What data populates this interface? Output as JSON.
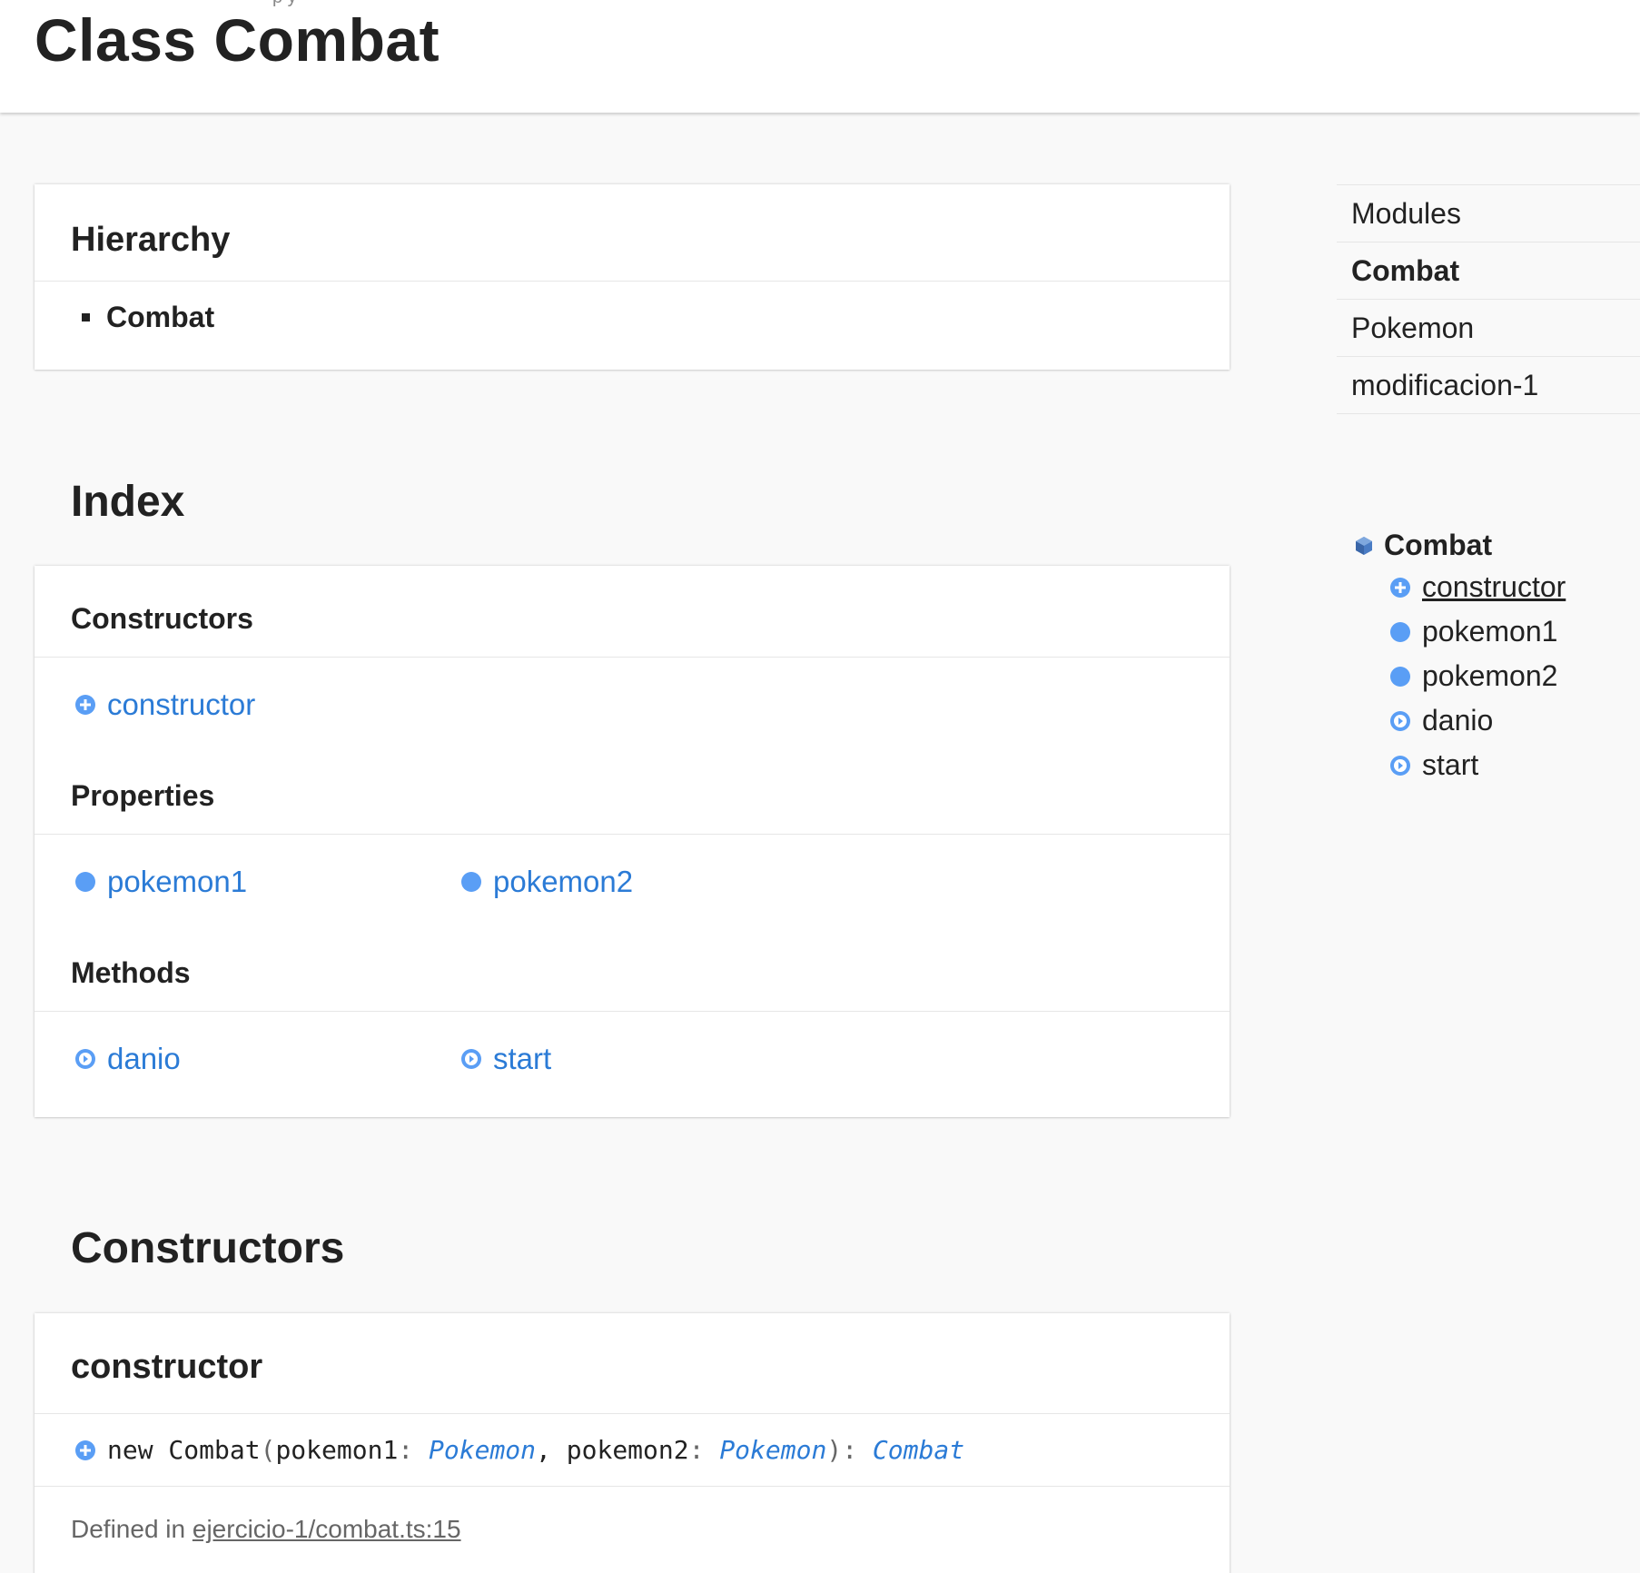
{
  "header": {
    "title": "Class Combat",
    "breadcrumb_fragment": "p  y"
  },
  "hierarchy": {
    "heading": "Hierarchy",
    "item": "Combat"
  },
  "index": {
    "heading": "Index",
    "constructors_heading": "Constructors",
    "constructors": [
      "constructor"
    ],
    "properties_heading": "Properties",
    "properties": [
      "pokemon1",
      "pokemon2"
    ],
    "methods_heading": "Methods",
    "methods": [
      "danio",
      "start"
    ]
  },
  "constructors_section": {
    "heading": "Constructors",
    "ctor_title": "constructor",
    "signature": {
      "prefix": "new Combat",
      "open": "(",
      "p1": "pokemon1",
      "colon": ": ",
      "t1": "Pokemon",
      "sep": ", ",
      "p2": "pokemon2",
      "t2": "Pokemon",
      "close": "): ",
      "ret": "Combat"
    },
    "defined_label": "Defined in ",
    "defined_link": "ejercicio-1/combat.ts:15"
  },
  "sidebar": {
    "nav": [
      "Modules",
      "Combat",
      "Pokemon",
      "modificacion-1"
    ],
    "active": "Combat",
    "toc_root": "Combat",
    "toc_items": [
      "constructor",
      "pokemon1",
      "pokemon2",
      "danio",
      "start"
    ]
  },
  "colors": {
    "link": "#2b7bd6",
    "icon_blue": "#5a9ef5",
    "class_icon": "#4a7cc4"
  }
}
